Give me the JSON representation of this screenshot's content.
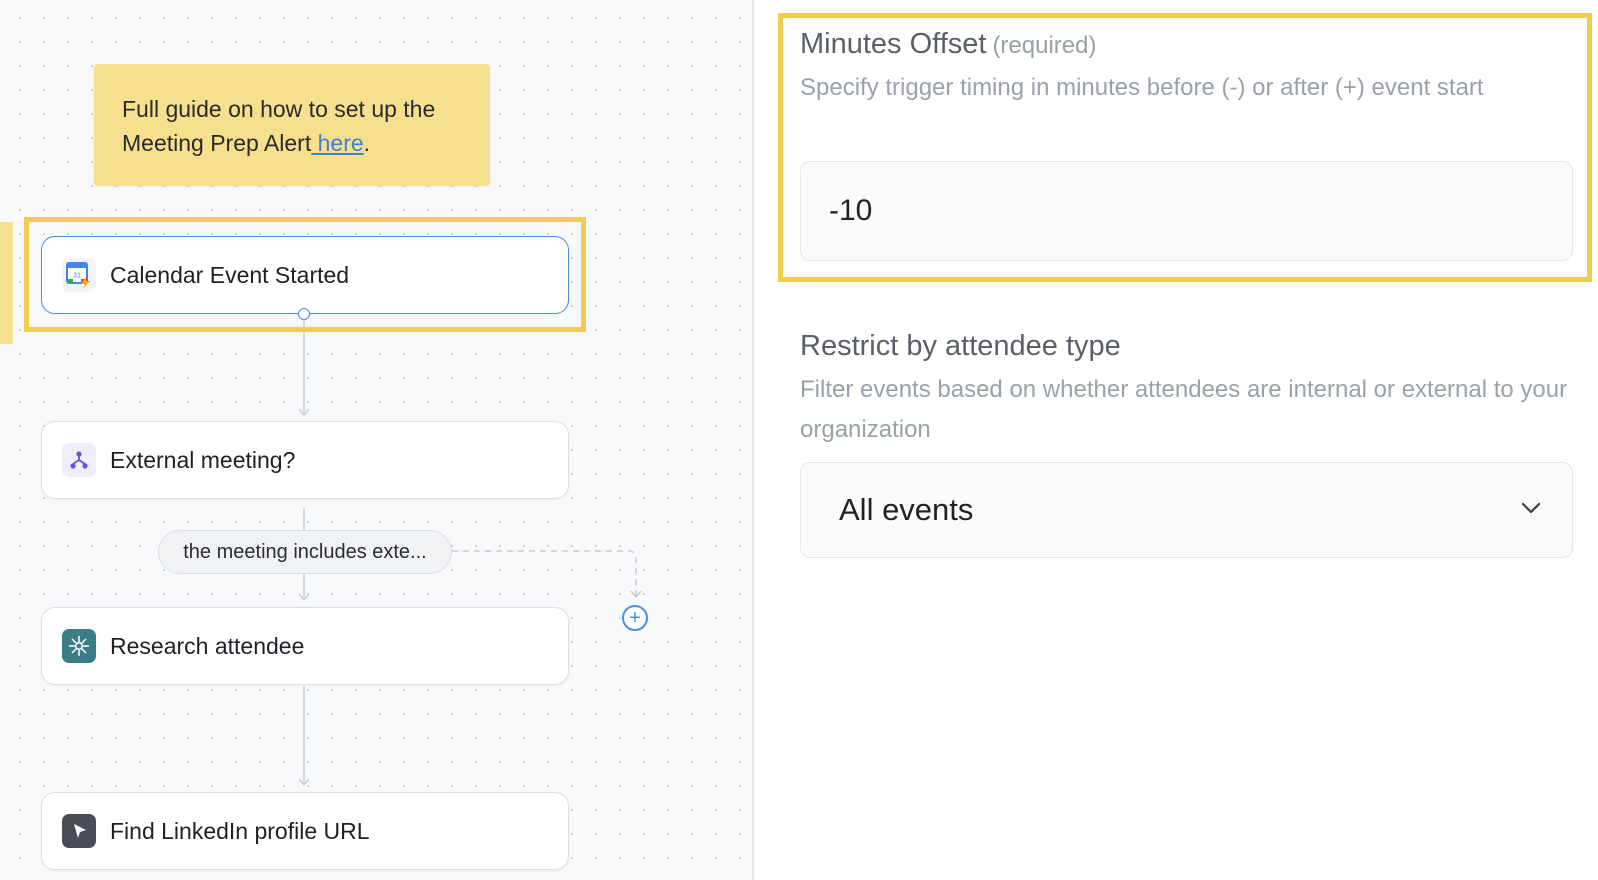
{
  "guide": {
    "text": "Full guide on how to set up the Meeting Prep Alert",
    "link": " here",
    "suffix": "."
  },
  "workflow": {
    "nodes": [
      {
        "label": "Calendar Event Started",
        "icon": "google-calendar-trigger-icon",
        "selected": true
      },
      {
        "label": "External meeting?",
        "icon": "branch-icon",
        "selected": false
      },
      {
        "label": "Research attendee",
        "icon": "research-agent-icon",
        "selected": false
      },
      {
        "label": "Find LinkedIn profile URL",
        "icon": "pointer-cursor-icon",
        "selected": false
      }
    ],
    "condition": "the meeting includes exte...",
    "add_step_symbol": "+"
  },
  "settings": {
    "minutes_offset": {
      "title": "Minutes Offset",
      "required": "(required)",
      "description": "Specify trigger timing in minutes before (-) or after (+) event start",
      "value": "-10"
    },
    "attendee_type": {
      "title": "Restrict by attendee type",
      "description": "Filter events based on whether attendees are internal or external to your organization",
      "selected": "All events"
    }
  },
  "colors": {
    "accent": "#4a8ee0",
    "highlight": "#f2cc50",
    "note_bg": "#f6e08d"
  }
}
